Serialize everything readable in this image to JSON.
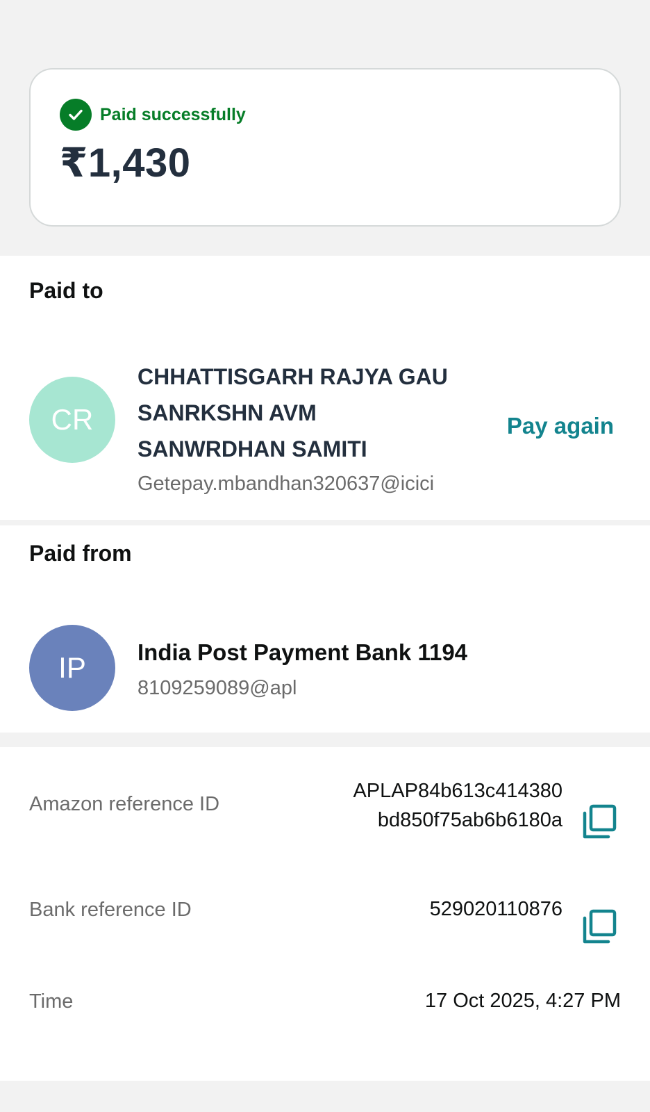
{
  "status": {
    "label": "Paid successfully",
    "amount": "₹1,430",
    "color": "#067d28"
  },
  "paid_to": {
    "section_title": "Paid to",
    "avatar_initials": "CR",
    "name_lines": [
      "CHHATTISGARH RAJYA GAU",
      "SANRKSHN AVM",
      "SANWRDHAN SAMITI"
    ],
    "upi_id": "Getepay.mbandhan320637@icici",
    "action_label": "Pay again",
    "action_color": "#13848e"
  },
  "paid_from": {
    "section_title": "Paid from",
    "avatar_initials": "IP",
    "bank_name": "India Post Payment Bank 1194",
    "upi_id": "8109259089@apl"
  },
  "details": {
    "amazon_ref": {
      "label": "Amazon reference ID",
      "value_lines": [
        "APLAP84b613c414380",
        "bd850f75ab6b6180a"
      ],
      "icon": "copy-icon"
    },
    "bank_ref": {
      "label": "Bank reference ID",
      "value": "529020110876",
      "icon": "copy-icon"
    },
    "time": {
      "label": "Time",
      "value": "17 Oct 2025, 4:27 PM"
    }
  }
}
